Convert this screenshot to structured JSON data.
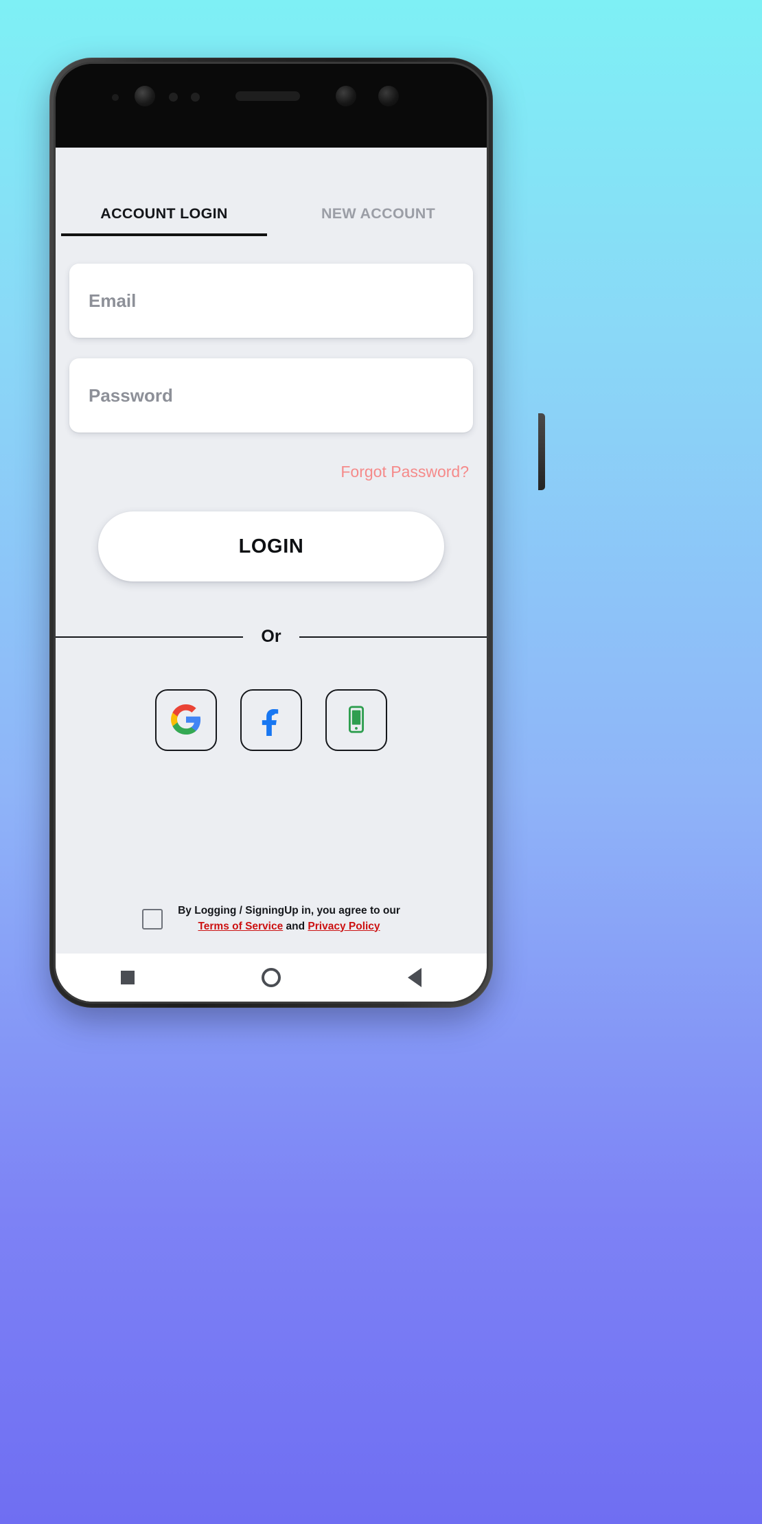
{
  "app": {
    "tabs": [
      {
        "label": "ACCOUNT LOGIN",
        "active": true
      },
      {
        "label": "NEW ACCOUNT",
        "active": false
      }
    ],
    "fields": {
      "email": {
        "placeholder": "Email",
        "value": ""
      },
      "password": {
        "placeholder": "Password",
        "value": ""
      }
    },
    "forgot_password_label": "Forgot Password?",
    "login_button_label": "LOGIN",
    "divider_label": "Or",
    "social": [
      {
        "name": "google-icon",
        "label": "G"
      },
      {
        "name": "facebook-icon",
        "label": "f"
      },
      {
        "name": "phone-icon",
        "label": ""
      }
    ],
    "terms": {
      "line1": "By Logging / SigningUp in, you agree to our",
      "terms_link": "Terms of Service",
      "conjunction": "and",
      "privacy_link": "Privacy Policy"
    },
    "navbar": [
      {
        "name": "recents-button"
      },
      {
        "name": "home-button"
      },
      {
        "name": "back-button"
      }
    ]
  },
  "colors": {
    "accent_pink": "#f58a8a",
    "link_red": "#cc1111",
    "screen_bg": "#eceef2",
    "tab_active": "#14161a",
    "tab_inactive": "#9b9ea6",
    "google_red": "#ea4335",
    "google_yellow": "#fbbc05",
    "google_green": "#34a853",
    "google_blue": "#4285f4",
    "facebook_blue": "#1877f2",
    "phone_green": "#2e9e4f"
  }
}
